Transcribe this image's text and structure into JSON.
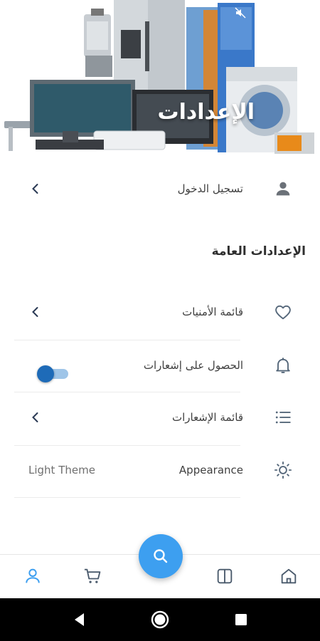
{
  "header": {
    "title": "الإعدادات",
    "status_icons": [
      "mute-icon",
      "dot-icon"
    ]
  },
  "account": {
    "login_label": "تسجيل الدخول",
    "icon": "person-icon"
  },
  "general_settings": {
    "section_title": "الإعدادات العامة",
    "items": [
      {
        "label": "قائمة الأمنيات",
        "icon": "heart-icon",
        "trail": "chevron"
      },
      {
        "label": "الحصول على إشعارات",
        "icon": "bell-icon",
        "trail": "toggle",
        "toggle_on": true
      },
      {
        "label": "قائمة الإشعارات",
        "icon": "list-icon",
        "trail": "chevron"
      },
      {
        "label": "Appearance",
        "icon": "sun-icon",
        "trail": "value",
        "value": "Light Theme"
      }
    ]
  },
  "bottom_nav": {
    "items": [
      "profile-icon",
      "cart-icon",
      "search-fab",
      "catalog-icon",
      "home-icon"
    ],
    "accent": "#3d9ff0"
  },
  "colors": {
    "accent": "#1e6bb8",
    "icon": "#5a6b7d",
    "fab": "#3d9ff0"
  }
}
